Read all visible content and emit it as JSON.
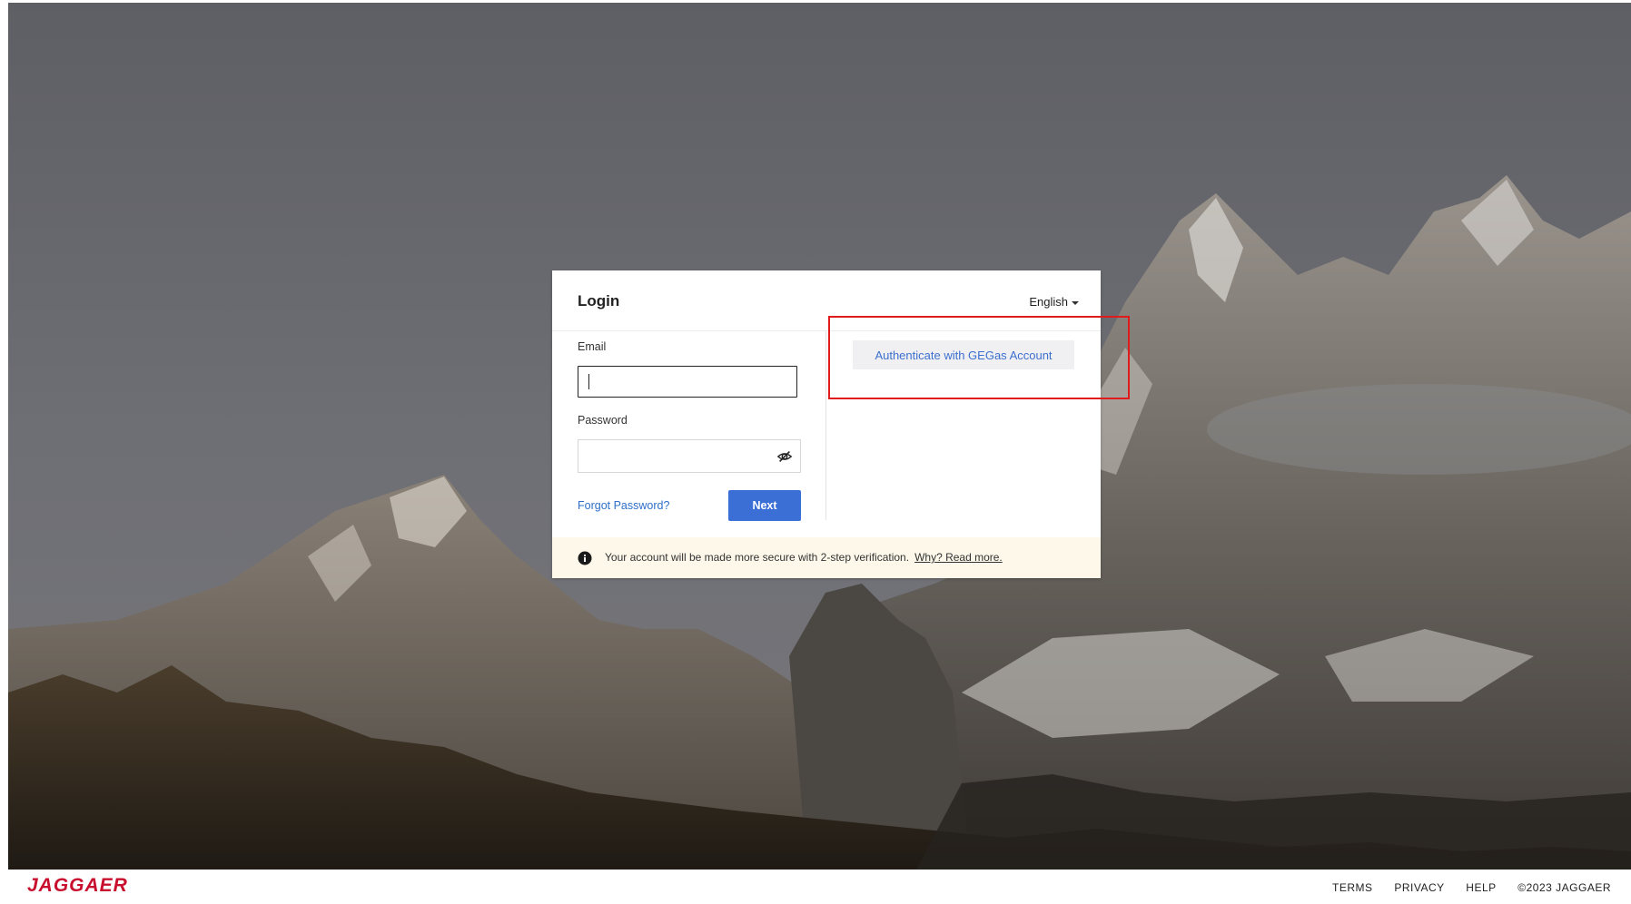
{
  "login": {
    "title": "Login",
    "language": "English",
    "email_label": "Email",
    "email_value": "",
    "password_label": "Password",
    "password_value": "",
    "forgot_password": "Forgot Password?",
    "next_button": "Next",
    "sso_button": "Authenticate with GEGas Account"
  },
  "notice": {
    "text": "Your account will be made more secure with 2-step verification.",
    "link": "Why? Read more."
  },
  "footer": {
    "logo": "JAGGAER",
    "links": [
      "TERMS",
      "PRIVACY",
      "HELP"
    ],
    "copyright": "©2023 JAGGAER"
  },
  "colors": {
    "primary_button": "#3b6fd6",
    "link": "#2f6fc9",
    "highlight": "#e01b1b",
    "brand": "#c8102e",
    "notice_bg": "#fdf8e9"
  },
  "icons": {
    "password_toggle": "eye-slash-icon",
    "notice": "info-icon",
    "language": "caret-down-icon"
  }
}
